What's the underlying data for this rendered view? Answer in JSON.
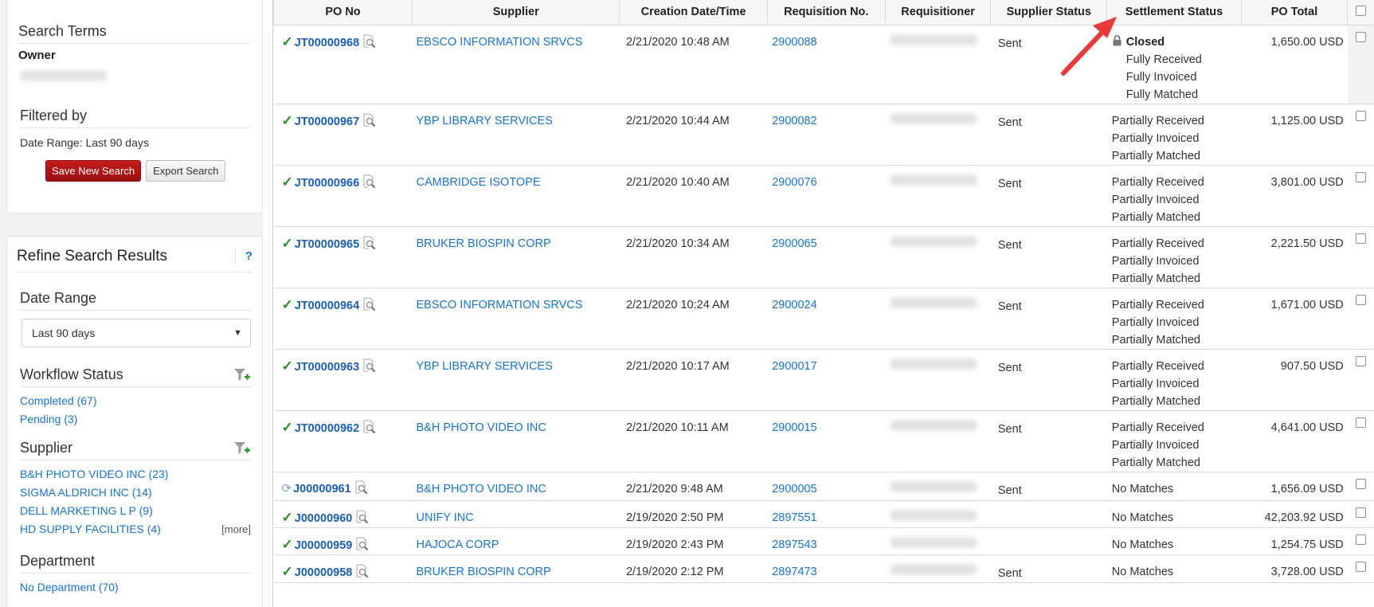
{
  "sidebar": {
    "search_terms": {
      "title": "Search Terms",
      "owner_label": "Owner",
      "filtered_by_title": "Filtered by",
      "date_range_text": "Date Range: Last 90 days",
      "save_button": "Save New Search",
      "export_button": "Export Search"
    },
    "refine": {
      "title": "Refine Search Results",
      "help": "?",
      "date_range_label": "Date Range",
      "date_range_value": "Last 90 days",
      "workflow_title": "Workflow Status",
      "workflow_items": [
        "Completed (67)",
        "Pending (3)"
      ],
      "supplier_title": "Supplier",
      "supplier_items": [
        "B&H PHOTO VIDEO INC (23)",
        "SIGMA ALDRICH INC (14)",
        "DELL MARKETING L P (9)",
        "HD SUPPLY FACILITIES (4)"
      ],
      "more": "[more]",
      "department_title": "Department",
      "department_items": [
        "No Department (70)"
      ]
    }
  },
  "table": {
    "headers": [
      "PO No",
      "Supplier",
      "Creation Date/Time",
      "Requisition No.",
      "Requisitioner",
      "Supplier Status",
      "Settlement Status",
      "PO Total"
    ],
    "rows": [
      {
        "po": "JT00000968",
        "status_icon": "check",
        "supplier": "EBSCO INFORMATION SRVCS",
        "date": "2/21/2020 10:48 AM",
        "req": "2900088",
        "sup_status": "Sent",
        "closed": true,
        "closed_label": "Closed",
        "settlement": [
          "Fully Received",
          "Fully Invoiced",
          "Fully Matched"
        ],
        "total": "1,650.00 USD"
      },
      {
        "po": "JT00000967",
        "status_icon": "check",
        "supplier": "YBP LIBRARY SERVICES",
        "date": "2/21/2020 10:44 AM",
        "req": "2900082",
        "sup_status": "Sent",
        "settlement": [
          "Partially Received",
          "Partially Invoiced",
          "Partially Matched"
        ],
        "total": "1,125.00 USD"
      },
      {
        "po": "JT00000966",
        "status_icon": "check",
        "supplier": "CAMBRIDGE ISOTOPE",
        "date": "2/21/2020 10:40 AM",
        "req": "2900076",
        "sup_status": "Sent",
        "settlement": [
          "Partially Received",
          "Partially Invoiced",
          "Partially Matched"
        ],
        "total": "3,801.00 USD"
      },
      {
        "po": "JT00000965",
        "status_icon": "check",
        "supplier": "BRUKER BIOSPIN CORP",
        "date": "2/21/2020 10:34 AM",
        "req": "2900065",
        "sup_status": "Sent",
        "settlement": [
          "Partially Received",
          "Partially Invoiced",
          "Partially Matched"
        ],
        "total": "2,221.50 USD"
      },
      {
        "po": "JT00000964",
        "status_icon": "check",
        "supplier": "EBSCO INFORMATION SRVCS",
        "date": "2/21/2020 10:24 AM",
        "req": "2900024",
        "sup_status": "Sent",
        "settlement": [
          "Partially Received",
          "Partially Invoiced",
          "Partially Matched"
        ],
        "total": "1,671.00 USD"
      },
      {
        "po": "JT00000963",
        "status_icon": "check",
        "supplier": "YBP LIBRARY SERVICES",
        "date": "2/21/2020 10:17 AM",
        "req": "2900017",
        "sup_status": "Sent",
        "settlement": [
          "Partially Received",
          "Partially Invoiced",
          "Partially Matched"
        ],
        "total": "907.50 USD"
      },
      {
        "po": "JT00000962",
        "status_icon": "check",
        "supplier": "B&H PHOTO VIDEO INC",
        "date": "2/21/2020 10:11 AM",
        "req": "2900015",
        "sup_status": "Sent",
        "settlement": [
          "Partially Received",
          "Partially Invoiced",
          "Partially Matched"
        ],
        "total": "4,641.00 USD"
      },
      {
        "po": "J00000961",
        "status_icon": "sync",
        "supplier": "B&H PHOTO VIDEO INC",
        "date": "2/21/2020 9:48 AM",
        "req": "2900005",
        "sup_status": "Sent",
        "settlement": [
          "No Matches"
        ],
        "total": "1,656.09 USD"
      },
      {
        "po": "J00000960",
        "status_icon": "check",
        "supplier": "UNIFY INC",
        "date": "2/19/2020 2:50 PM",
        "req": "2897551",
        "sup_status": "",
        "settlement": [
          "No Matches"
        ],
        "total": "42,203.92 USD"
      },
      {
        "po": "J00000959",
        "status_icon": "check",
        "supplier": "HAJOCA CORP",
        "date": "2/19/2020 2:43 PM",
        "req": "2897543",
        "sup_status": "",
        "settlement": [
          "No Matches"
        ],
        "total": "1,254.75 USD"
      },
      {
        "po": "J00000958",
        "status_icon": "check",
        "supplier": "BRUKER BIOSPIN CORP",
        "date": "2/19/2020 2:12 PM",
        "req": "2897473",
        "sup_status": "Sent",
        "settlement": [
          "No Matches"
        ],
        "total": "3,728.00 USD"
      }
    ]
  },
  "colors": {
    "link": "#1a73c8",
    "check": "#2e8b2e",
    "arrow": "#e8393b",
    "button_red": "#b01414"
  }
}
